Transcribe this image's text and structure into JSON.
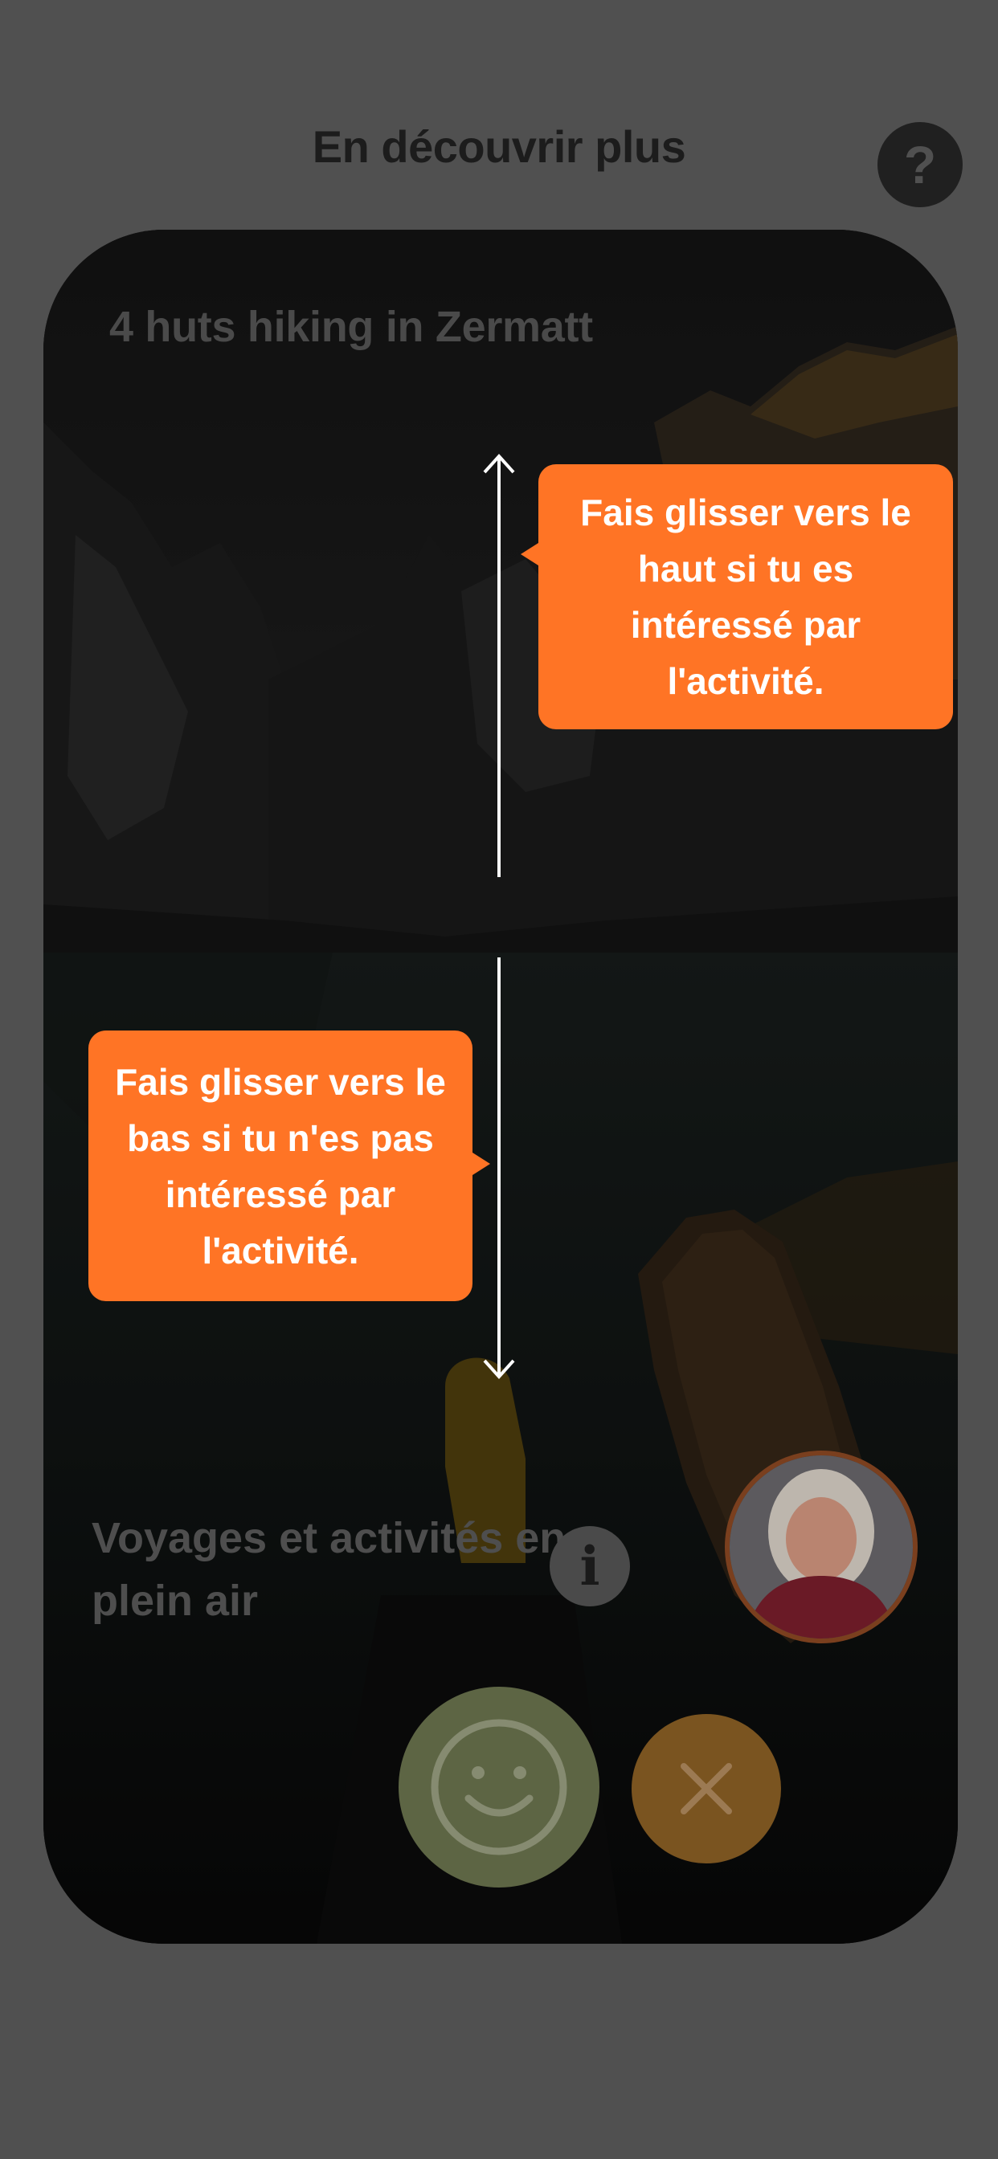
{
  "header": {
    "title": "En découvrir plus",
    "help_label": "?"
  },
  "card": {
    "activity_title": "4 huts hiking in Zermatt",
    "category_title": "Voyages et activités en plein air",
    "info_label": "i"
  },
  "actions": {
    "like_icon": "smiley-icon",
    "dislike_icon": "close-icon"
  },
  "onboarding": {
    "swipe_up_hint": "Fais glisser vers le haut si tu es intéressé par l'activité.",
    "swipe_down_hint": "Fais glisser vers le bas si tu n'es pas intéressé par l'activité."
  },
  "colors": {
    "accent": "#ff7425",
    "like": "#5d6544",
    "dislike": "#7a5420",
    "background": "#505050"
  }
}
